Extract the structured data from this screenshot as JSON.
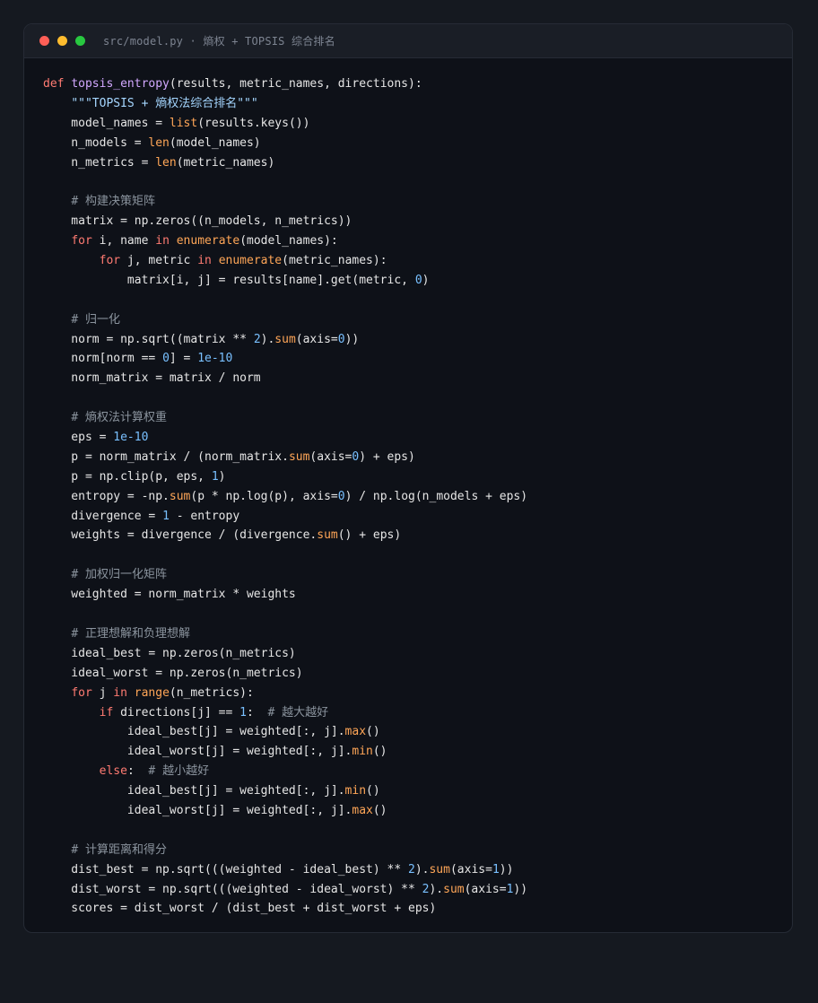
{
  "window": {
    "title": "src/model.py · 熵权 + TOPSIS 综合排名",
    "controls": [
      {
        "name": "close",
        "color": "#ff5f57"
      },
      {
        "name": "minimize",
        "color": "#febc2e"
      },
      {
        "name": "maximize",
        "color": "#28c840"
      }
    ]
  },
  "colors": {
    "keyword": "#ff7b72",
    "function_name": "#d2a8ff",
    "builtin": "#ffa657",
    "number": "#79c0ff",
    "string": "#a5d6ff",
    "comment": "#8b949e",
    "text": "#e6e6e6"
  },
  "code": [
    [
      [
        "kw",
        "def "
      ],
      [
        "fn",
        "topsis_entropy"
      ],
      [
        "plain",
        "(results, metric_names, directions):"
      ]
    ],
    [
      [
        "plain",
        "    "
      ],
      [
        "str",
        "\"\"\"TOPSIS + 熵权法综合排名\"\"\""
      ]
    ],
    [
      [
        "plain",
        "    model_names = "
      ],
      [
        "bi",
        "list"
      ],
      [
        "plain",
        "(results.keys())"
      ]
    ],
    [
      [
        "plain",
        "    n_models = "
      ],
      [
        "bi",
        "len"
      ],
      [
        "plain",
        "(model_names)"
      ]
    ],
    [
      [
        "plain",
        "    n_metrics = "
      ],
      [
        "bi",
        "len"
      ],
      [
        "plain",
        "(metric_names)"
      ]
    ],
    [],
    [
      [
        "plain",
        "    "
      ],
      [
        "com",
        "# 构建决策矩阵"
      ]
    ],
    [
      [
        "plain",
        "    matrix = np.zeros((n_models, n_metrics))"
      ]
    ],
    [
      [
        "plain",
        "    "
      ],
      [
        "kw",
        "for"
      ],
      [
        "plain",
        " i, name "
      ],
      [
        "kw",
        "in"
      ],
      [
        "plain",
        " "
      ],
      [
        "bi",
        "enumerate"
      ],
      [
        "plain",
        "(model_names):"
      ]
    ],
    [
      [
        "plain",
        "        "
      ],
      [
        "kw",
        "for"
      ],
      [
        "plain",
        " j, metric "
      ],
      [
        "kw",
        "in"
      ],
      [
        "plain",
        " "
      ],
      [
        "bi",
        "enumerate"
      ],
      [
        "plain",
        "(metric_names):"
      ]
    ],
    [
      [
        "plain",
        "            matrix[i, j] = results[name].get(metric, "
      ],
      [
        "num",
        "0"
      ],
      [
        "plain",
        ")"
      ]
    ],
    [],
    [
      [
        "plain",
        "    "
      ],
      [
        "com",
        "# 归一化"
      ]
    ],
    [
      [
        "plain",
        "    norm = np.sqrt((matrix ** "
      ],
      [
        "num",
        "2"
      ],
      [
        "plain",
        ")."
      ],
      [
        "bi",
        "sum"
      ],
      [
        "plain",
        "(axis="
      ],
      [
        "num",
        "0"
      ],
      [
        "plain",
        "))"
      ]
    ],
    [
      [
        "plain",
        "    norm[norm == "
      ],
      [
        "num",
        "0"
      ],
      [
        "plain",
        "] = "
      ],
      [
        "num",
        "1e-10"
      ]
    ],
    [
      [
        "plain",
        "    norm_matrix = matrix / norm"
      ]
    ],
    [],
    [
      [
        "plain",
        "    "
      ],
      [
        "com",
        "# 熵权法计算权重"
      ]
    ],
    [
      [
        "plain",
        "    eps = "
      ],
      [
        "num",
        "1e-10"
      ]
    ],
    [
      [
        "plain",
        "    p = norm_matrix / (norm_matrix."
      ],
      [
        "bi",
        "sum"
      ],
      [
        "plain",
        "(axis="
      ],
      [
        "num",
        "0"
      ],
      [
        "plain",
        ") + eps)"
      ]
    ],
    [
      [
        "plain",
        "    p = np.clip(p, eps, "
      ],
      [
        "num",
        "1"
      ],
      [
        "plain",
        ")"
      ]
    ],
    [
      [
        "plain",
        "    entropy = -np."
      ],
      [
        "bi",
        "sum"
      ],
      [
        "plain",
        "(p * np.log(p), axis="
      ],
      [
        "num",
        "0"
      ],
      [
        "plain",
        ") / np.log(n_models + eps)"
      ]
    ],
    [
      [
        "plain",
        "    divergence = "
      ],
      [
        "num",
        "1"
      ],
      [
        "plain",
        " - entropy"
      ]
    ],
    [
      [
        "plain",
        "    weights = divergence / (divergence."
      ],
      [
        "bi",
        "sum"
      ],
      [
        "plain",
        "() + eps)"
      ]
    ],
    [],
    [
      [
        "plain",
        "    "
      ],
      [
        "com",
        "# 加权归一化矩阵"
      ]
    ],
    [
      [
        "plain",
        "    weighted = norm_matrix * weights"
      ]
    ],
    [],
    [
      [
        "plain",
        "    "
      ],
      [
        "com",
        "# 正理想解和负理想解"
      ]
    ],
    [
      [
        "plain",
        "    ideal_best = np.zeros(n_metrics)"
      ]
    ],
    [
      [
        "plain",
        "    ideal_worst = np.zeros(n_metrics)"
      ]
    ],
    [
      [
        "plain",
        "    "
      ],
      [
        "kw",
        "for"
      ],
      [
        "plain",
        " j "
      ],
      [
        "kw",
        "in"
      ],
      [
        "plain",
        " "
      ],
      [
        "bi",
        "range"
      ],
      [
        "plain",
        "(n_metrics):"
      ]
    ],
    [
      [
        "plain",
        "        "
      ],
      [
        "kw",
        "if"
      ],
      [
        "plain",
        " directions[j] == "
      ],
      [
        "num",
        "1"
      ],
      [
        "plain",
        ":  "
      ],
      [
        "com",
        "# 越大越好"
      ]
    ],
    [
      [
        "plain",
        "            ideal_best[j] = weighted[:, j]."
      ],
      [
        "bi",
        "max"
      ],
      [
        "plain",
        "()"
      ]
    ],
    [
      [
        "plain",
        "            ideal_worst[j] = weighted[:, j]."
      ],
      [
        "bi",
        "min"
      ],
      [
        "plain",
        "()"
      ]
    ],
    [
      [
        "plain",
        "        "
      ],
      [
        "kw",
        "else"
      ],
      [
        "plain",
        ":  "
      ],
      [
        "com",
        "# 越小越好"
      ]
    ],
    [
      [
        "plain",
        "            ideal_best[j] = weighted[:, j]."
      ],
      [
        "bi",
        "min"
      ],
      [
        "plain",
        "()"
      ]
    ],
    [
      [
        "plain",
        "            ideal_worst[j] = weighted[:, j]."
      ],
      [
        "bi",
        "max"
      ],
      [
        "plain",
        "()"
      ]
    ],
    [],
    [
      [
        "plain",
        "    "
      ],
      [
        "com",
        "# 计算距离和得分"
      ]
    ],
    [
      [
        "plain",
        "    dist_best = np.sqrt(((weighted - ideal_best) ** "
      ],
      [
        "num",
        "2"
      ],
      [
        "plain",
        ")."
      ],
      [
        "bi",
        "sum"
      ],
      [
        "plain",
        "(axis="
      ],
      [
        "num",
        "1"
      ],
      [
        "plain",
        "))"
      ]
    ],
    [
      [
        "plain",
        "    dist_worst = np.sqrt(((weighted - ideal_worst) ** "
      ],
      [
        "num",
        "2"
      ],
      [
        "plain",
        ")."
      ],
      [
        "bi",
        "sum"
      ],
      [
        "plain",
        "(axis="
      ],
      [
        "num",
        "1"
      ],
      [
        "plain",
        "))"
      ]
    ],
    [
      [
        "plain",
        "    scores = dist_worst / (dist_best + dist_worst + eps)"
      ]
    ]
  ]
}
